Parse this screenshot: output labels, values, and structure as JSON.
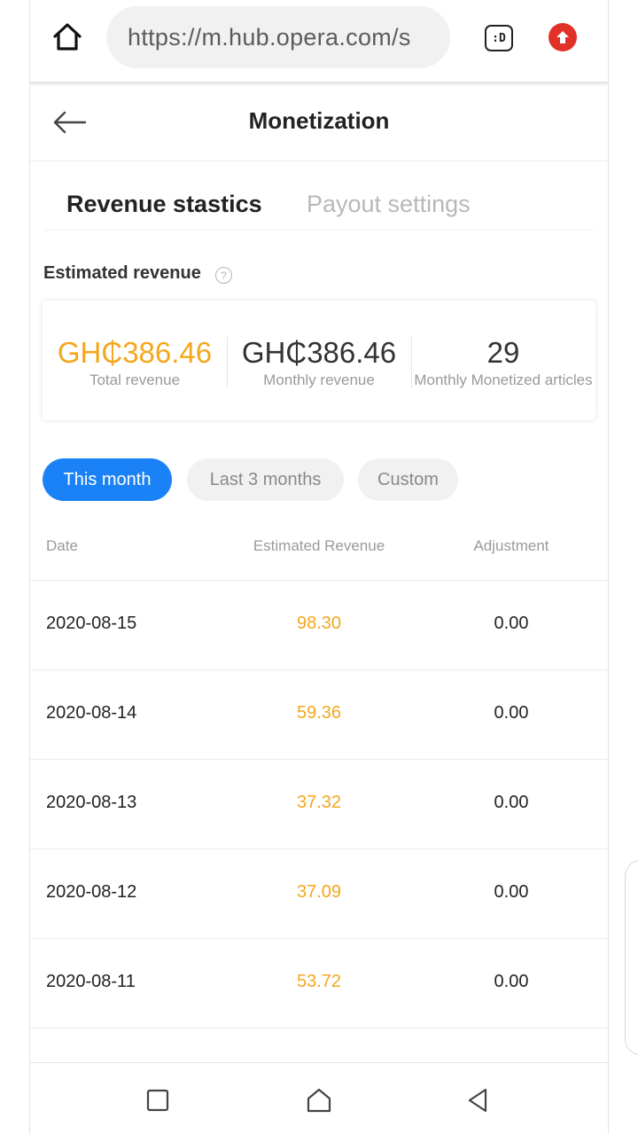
{
  "browser": {
    "url": "https://m.hub.opera.com/s",
    "tab_label": ":D"
  },
  "header": {
    "title": "Monetization"
  },
  "tabs": [
    {
      "label": "Revenue stastics",
      "active": true
    },
    {
      "label": "Payout settings",
      "active": false
    }
  ],
  "estimated_revenue": {
    "label": "Estimated revenue",
    "help_symbol": "?",
    "items": [
      {
        "value": "GH₵386.46",
        "caption": "Total revenue"
      },
      {
        "value": "GH₵386.46",
        "caption": "Monthly revenue"
      },
      {
        "value": "29",
        "caption": "Monthly Monetized articles"
      }
    ]
  },
  "filters": [
    {
      "label": "This month",
      "active": true
    },
    {
      "label": "Last 3 months",
      "active": false
    },
    {
      "label": "Custom",
      "active": false
    }
  ],
  "table": {
    "headers": [
      "Date",
      "Estimated Revenue",
      "Adjustment"
    ],
    "rows": [
      {
        "date": "2020-08-15",
        "revenue": "98.30",
        "adjustment": "0.00"
      },
      {
        "date": "2020-08-14",
        "revenue": "59.36",
        "adjustment": "0.00"
      },
      {
        "date": "2020-08-13",
        "revenue": "37.32",
        "adjustment": "0.00"
      },
      {
        "date": "2020-08-12",
        "revenue": "37.09",
        "adjustment": "0.00"
      },
      {
        "date": "2020-08-11",
        "revenue": "53.72",
        "adjustment": "0.00"
      }
    ]
  },
  "colors": {
    "accent_blue": "#1a82f6",
    "revenue_orange": "#f4a71c",
    "upload_red": "#e03228"
  },
  "icons": {
    "home": "home-icon",
    "tabs": "tabs-icon",
    "upload": "upload-icon",
    "back": "back-arrow-icon",
    "help": "help-icon",
    "nav_recent": "recent-apps-icon",
    "nav_home": "nav-home-icon",
    "nav_back": "nav-back-icon"
  }
}
